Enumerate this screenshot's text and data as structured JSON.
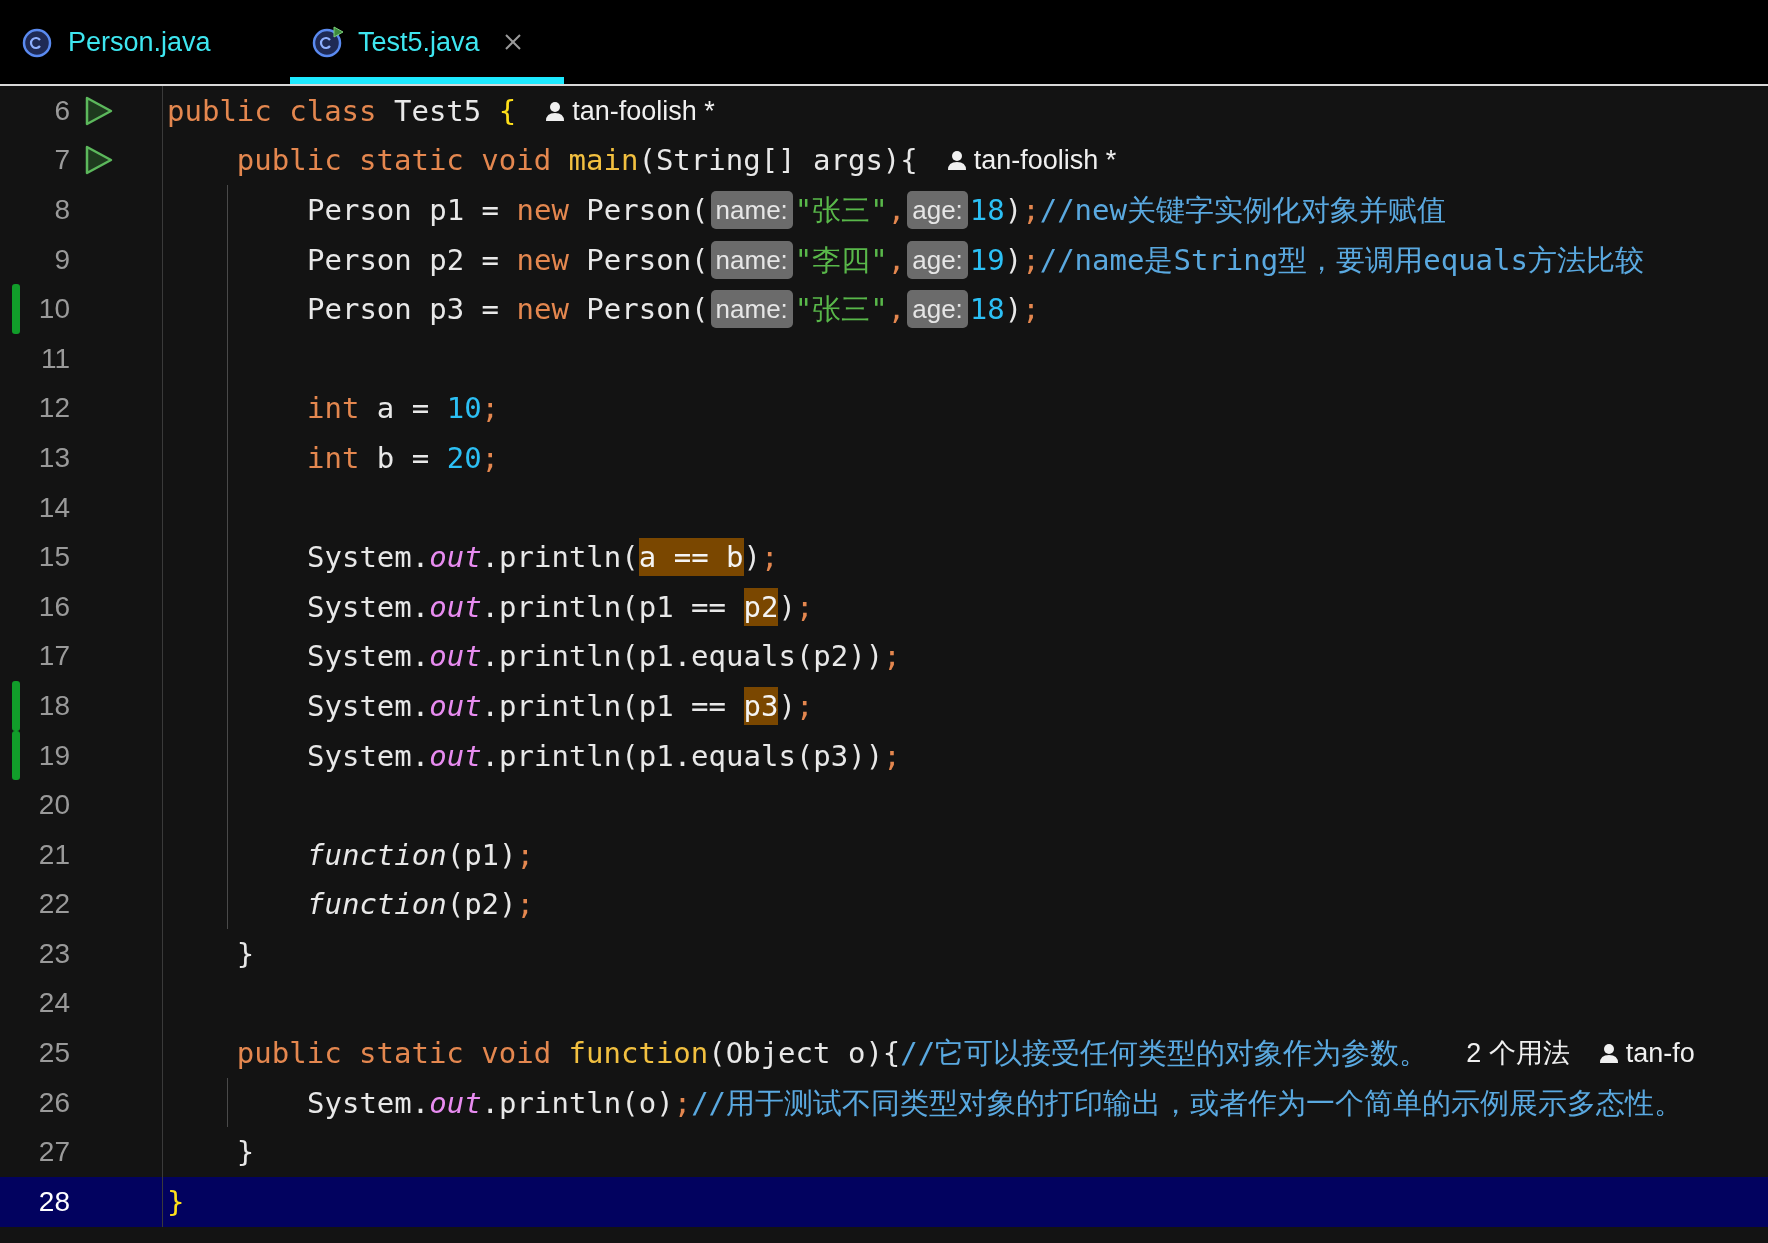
{
  "tabs": [
    {
      "label": "Person.java",
      "selected": false,
      "kind": "class",
      "closable": false
    },
    {
      "label": "Test5.java",
      "selected": true,
      "kind": "runnable",
      "closable": true
    }
  ],
  "lines": [
    {
      "number": "6",
      "run": true,
      "changed": false,
      "current": false,
      "guide": false,
      "tokens": [
        {
          "text": "public class ",
          "kind": "kw"
        },
        {
          "text": "Test5 ",
          "kind": "plain"
        },
        {
          "text": "{",
          "kind": "brace"
        },
        {
          "text": "tan-foolish *",
          "kind": "author"
        }
      ]
    },
    {
      "number": "7",
      "run": true,
      "changed": false,
      "current": false,
      "guide": false,
      "tokens": [
        {
          "text": "    public static void ",
          "kind": "kw"
        },
        {
          "text": "main",
          "kind": "fn"
        },
        {
          "text": "(String[] args){",
          "kind": "plain"
        },
        {
          "text": "tan-foolish *",
          "kind": "author"
        }
      ]
    },
    {
      "number": "8",
      "run": false,
      "changed": false,
      "current": false,
      "guide": true,
      "tokens": [
        {
          "text": "Person p1 = ",
          "kind": "plain"
        },
        {
          "text": "new ",
          "kind": "kw"
        },
        {
          "text": "Person(",
          "kind": "plain"
        },
        {
          "text": "name:",
          "kind": "hint"
        },
        {
          "text": "\"张三\"",
          "kind": "str"
        },
        {
          "text": ",",
          "kind": "semi"
        },
        {
          "text": "age:",
          "kind": "hint"
        },
        {
          "text": "18",
          "kind": "num"
        },
        {
          "text": ")",
          "kind": "plain"
        },
        {
          "text": ";",
          "kind": "semi"
        },
        {
          "text": "//new关键字实例化对象并赋值",
          "kind": "cm"
        }
      ]
    },
    {
      "number": "9",
      "run": false,
      "changed": false,
      "current": false,
      "guide": true,
      "tokens": [
        {
          "text": "Person p2 = ",
          "kind": "plain"
        },
        {
          "text": "new ",
          "kind": "kw"
        },
        {
          "text": "Person(",
          "kind": "plain"
        },
        {
          "text": "name:",
          "kind": "hint"
        },
        {
          "text": "\"李四\"",
          "kind": "str"
        },
        {
          "text": ",",
          "kind": "semi"
        },
        {
          "text": "age:",
          "kind": "hint"
        },
        {
          "text": "19",
          "kind": "num"
        },
        {
          "text": ")",
          "kind": "plain"
        },
        {
          "text": ";",
          "kind": "semi"
        },
        {
          "text": "//name是String型，要调用equals方法比较",
          "kind": "cm"
        }
      ]
    },
    {
      "number": "10",
      "run": false,
      "changed": true,
      "current": false,
      "guide": true,
      "tokens": [
        {
          "text": "Person p3 = ",
          "kind": "plain"
        },
        {
          "text": "new ",
          "kind": "kw"
        },
        {
          "text": "Person(",
          "kind": "plain"
        },
        {
          "text": "name:",
          "kind": "hint"
        },
        {
          "text": "\"张三\"",
          "kind": "str"
        },
        {
          "text": ",",
          "kind": "semi"
        },
        {
          "text": "age:",
          "kind": "hint"
        },
        {
          "text": "18",
          "kind": "num"
        },
        {
          "text": ")",
          "kind": "plain"
        },
        {
          "text": ";",
          "kind": "semi"
        }
      ]
    },
    {
      "number": "11",
      "run": false,
      "changed": false,
      "current": false,
      "guide": true
    },
    {
      "number": "12",
      "run": false,
      "changed": false,
      "current": false,
      "guide": true,
      "tokens": [
        {
          "text": "int ",
          "kind": "kw"
        },
        {
          "text": "a = ",
          "kind": "plain"
        },
        {
          "text": "10",
          "kind": "num"
        },
        {
          "text": ";",
          "kind": "semi"
        }
      ]
    },
    {
      "number": "13",
      "run": false,
      "changed": false,
      "current": false,
      "guide": true,
      "tokens": [
        {
          "text": "int ",
          "kind": "kw"
        },
        {
          "text": "b = ",
          "kind": "plain"
        },
        {
          "text": "20",
          "kind": "num"
        },
        {
          "text": ";",
          "kind": "semi"
        }
      ]
    },
    {
      "number": "14",
      "run": false,
      "changed": false,
      "current": false,
      "guide": true
    },
    {
      "number": "15",
      "run": false,
      "changed": false,
      "current": false,
      "guide": true,
      "tokens": [
        {
          "text": "System.",
          "kind": "plain"
        },
        {
          "text": "out",
          "kind": "static"
        },
        {
          "text": ".println(",
          "kind": "plain"
        },
        {
          "text": "a == b",
          "kind": "hl"
        },
        {
          "text": ")",
          "kind": "plain"
        },
        {
          "text": ";",
          "kind": "semi"
        }
      ]
    },
    {
      "number": "16",
      "run": false,
      "changed": false,
      "current": false,
      "guide": true,
      "tokens": [
        {
          "text": "System.",
          "kind": "plain"
        },
        {
          "text": "out",
          "kind": "static"
        },
        {
          "text": ".println(p1 == ",
          "kind": "plain"
        },
        {
          "text": "p2",
          "kind": "hl"
        },
        {
          "text": ")",
          "kind": "plain"
        },
        {
          "text": ";",
          "kind": "semi"
        }
      ]
    },
    {
      "number": "17",
      "run": false,
      "changed": false,
      "current": false,
      "guide": true,
      "tokens": [
        {
          "text": "System.",
          "kind": "plain"
        },
        {
          "text": "out",
          "kind": "static"
        },
        {
          "text": ".println(p1.equals(p2))",
          "kind": "plain"
        },
        {
          "text": ";",
          "kind": "semi"
        }
      ]
    },
    {
      "number": "18",
      "run": false,
      "changed": true,
      "current": false,
      "guide": true,
      "tokens": [
        {
          "text": "System.",
          "kind": "plain"
        },
        {
          "text": "out",
          "kind": "static"
        },
        {
          "text": ".println(p1 == ",
          "kind": "plain"
        },
        {
          "text": "p3",
          "kind": "hl"
        },
        {
          "text": ")",
          "kind": "plain"
        },
        {
          "text": ";",
          "kind": "semi"
        }
      ]
    },
    {
      "number": "19",
      "run": false,
      "changed": true,
      "current": false,
      "guide": true,
      "tokens": [
        {
          "text": "System.",
          "kind": "plain"
        },
        {
          "text": "out",
          "kind": "static"
        },
        {
          "text": ".println(p1.equals(p3))",
          "kind": "plain"
        },
        {
          "text": ";",
          "kind": "semi"
        }
      ]
    },
    {
      "number": "20",
      "run": false,
      "changed": false,
      "current": false,
      "guide": true
    },
    {
      "number": "21",
      "run": false,
      "changed": false,
      "current": false,
      "guide": true,
      "tokens": [
        {
          "text": "function",
          "kind": "italic"
        },
        {
          "text": "(p1)",
          "kind": "plain"
        },
        {
          "text": ";",
          "kind": "semi"
        }
      ]
    },
    {
      "number": "22",
      "run": false,
      "changed": false,
      "current": false,
      "guide": true,
      "tokens": [
        {
          "text": "function",
          "kind": "italic"
        },
        {
          "text": "(p2)",
          "kind": "plain"
        },
        {
          "text": ";",
          "kind": "semi"
        }
      ]
    },
    {
      "number": "23",
      "run": false,
      "changed": false,
      "current": false,
      "guide": false,
      "tokens": [
        {
          "text": "    }",
          "kind": "plain"
        }
      ]
    },
    {
      "number": "24",
      "run": false,
      "changed": false,
      "current": false,
      "guide": false
    },
    {
      "number": "25",
      "run": false,
      "changed": false,
      "current": false,
      "guide": false,
      "tokens": [
        {
          "text": "    public static void ",
          "kind": "kw"
        },
        {
          "text": "function",
          "kind": "fn"
        },
        {
          "text": "(Object o){",
          "kind": "plain"
        },
        {
          "text": "//它可以接受任何类型的对象作为参数。",
          "kind": "cm"
        },
        {
          "text": "2 个用法",
          "kind": "usages"
        },
        {
          "text": "tan-fo",
          "kind": "author"
        }
      ]
    },
    {
      "number": "26",
      "run": false,
      "changed": false,
      "current": false,
      "guide": true,
      "tokens": [
        {
          "text": "System.",
          "kind": "plain"
        },
        {
          "text": "out",
          "kind": "static"
        },
        {
          "text": ".println(o)",
          "kind": "plain"
        },
        {
          "text": ";",
          "kind": "semi"
        },
        {
          "text": "//用于测试不同类型对象的打印输出，或者作为一个简单的示例展示多态性。",
          "kind": "cm"
        }
      ]
    },
    {
      "number": "27",
      "run": false,
      "changed": false,
      "current": false,
      "guide": false,
      "tokens": [
        {
          "text": "    }",
          "kind": "plain"
        }
      ]
    },
    {
      "number": "28",
      "run": false,
      "changed": false,
      "current": true,
      "guide": false,
      "tokens": [
        {
          "text": "}",
          "kind": "brace"
        }
      ]
    }
  ]
}
